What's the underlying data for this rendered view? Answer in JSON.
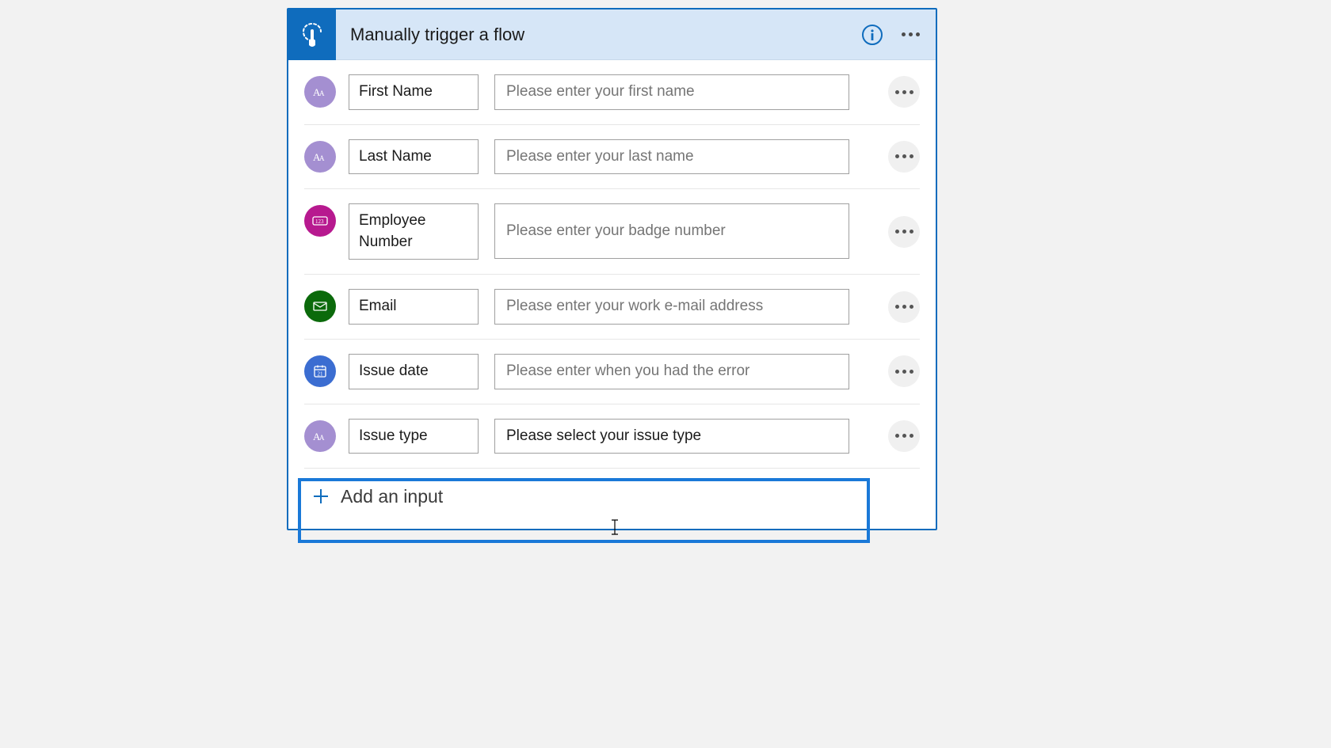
{
  "header": {
    "title": "Manually trigger a flow"
  },
  "inputs": [
    {
      "icon": "text",
      "name": "First Name",
      "placeholder": "Please enter your first name"
    },
    {
      "icon": "text",
      "name": "Last Name",
      "placeholder": "Please enter your last name"
    },
    {
      "icon": "number",
      "name": "Employee Number",
      "placeholder": "Please enter your badge number"
    },
    {
      "icon": "email",
      "name": "Email",
      "placeholder": "Please enter your work e-mail address"
    },
    {
      "icon": "date",
      "name": "Issue date",
      "placeholder": "Please enter when you had the error"
    },
    {
      "icon": "text",
      "name": "Issue type",
      "value": "Please select your issue type"
    }
  ],
  "addInput": {
    "label": "Add an input"
  }
}
